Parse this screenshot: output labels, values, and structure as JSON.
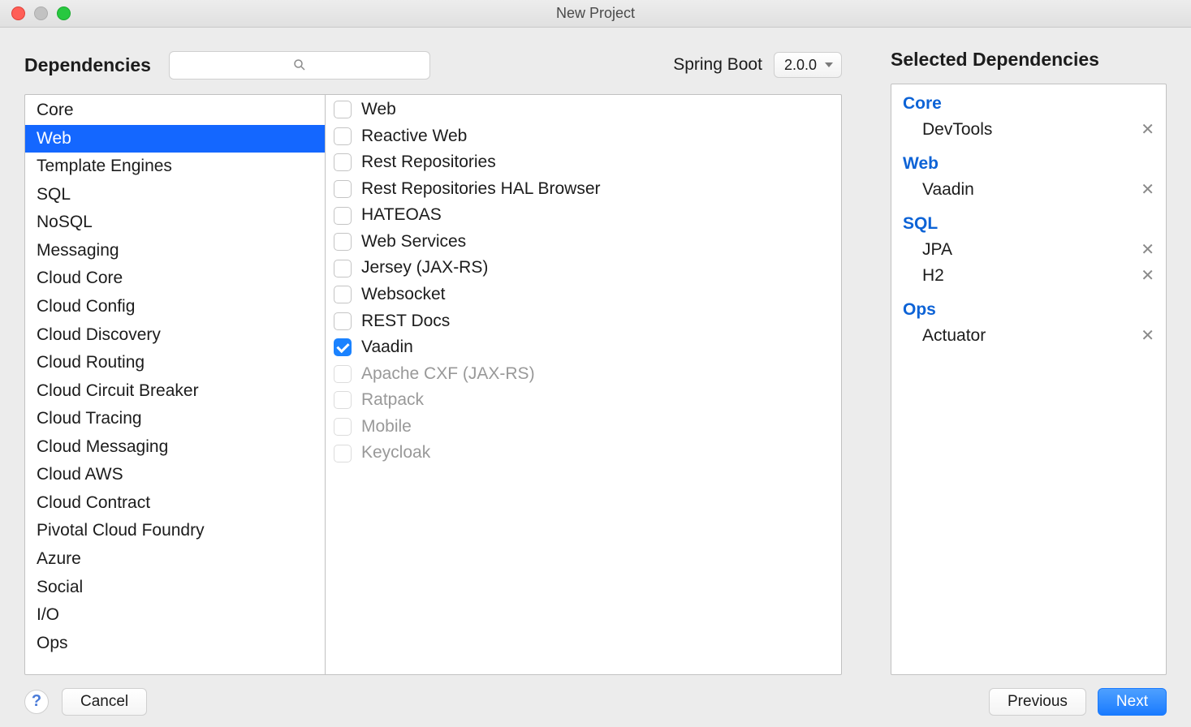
{
  "window": {
    "title": "New Project"
  },
  "header": {
    "dependencies_label": "Dependencies",
    "search_placeholder": "",
    "spring_boot_label": "Spring Boot",
    "spring_boot_version": "2.0.0"
  },
  "categories": [
    {
      "label": "Core",
      "selected": false
    },
    {
      "label": "Web",
      "selected": true
    },
    {
      "label": "Template Engines",
      "selected": false
    },
    {
      "label": "SQL",
      "selected": false
    },
    {
      "label": "NoSQL",
      "selected": false
    },
    {
      "label": "Messaging",
      "selected": false
    },
    {
      "label": "Cloud Core",
      "selected": false
    },
    {
      "label": "Cloud Config",
      "selected": false
    },
    {
      "label": "Cloud Discovery",
      "selected": false
    },
    {
      "label": "Cloud Routing",
      "selected": false
    },
    {
      "label": "Cloud Circuit Breaker",
      "selected": false
    },
    {
      "label": "Cloud Tracing",
      "selected": false
    },
    {
      "label": "Cloud Messaging",
      "selected": false
    },
    {
      "label": "Cloud AWS",
      "selected": false
    },
    {
      "label": "Cloud Contract",
      "selected": false
    },
    {
      "label": "Pivotal Cloud Foundry",
      "selected": false
    },
    {
      "label": "Azure",
      "selected": false
    },
    {
      "label": "Social",
      "selected": false
    },
    {
      "label": "I/O",
      "selected": false
    },
    {
      "label": "Ops",
      "selected": false
    }
  ],
  "options": [
    {
      "label": "Web",
      "checked": false,
      "disabled": false
    },
    {
      "label": "Reactive Web",
      "checked": false,
      "disabled": false
    },
    {
      "label": "Rest Repositories",
      "checked": false,
      "disabled": false
    },
    {
      "label": "Rest Repositories HAL Browser",
      "checked": false,
      "disabled": false
    },
    {
      "label": "HATEOAS",
      "checked": false,
      "disabled": false
    },
    {
      "label": "Web Services",
      "checked": false,
      "disabled": false
    },
    {
      "label": "Jersey (JAX-RS)",
      "checked": false,
      "disabled": false
    },
    {
      "label": "Websocket",
      "checked": false,
      "disabled": false
    },
    {
      "label": "REST Docs",
      "checked": false,
      "disabled": false
    },
    {
      "label": "Vaadin",
      "checked": true,
      "disabled": false
    },
    {
      "label": "Apache CXF (JAX-RS)",
      "checked": false,
      "disabled": true
    },
    {
      "label": "Ratpack",
      "checked": false,
      "disabled": true
    },
    {
      "label": "Mobile",
      "checked": false,
      "disabled": true
    },
    {
      "label": "Keycloak",
      "checked": false,
      "disabled": true
    }
  ],
  "selected": {
    "title": "Selected Dependencies",
    "groups": [
      {
        "name": "Core",
        "items": [
          "DevTools"
        ]
      },
      {
        "name": "Web",
        "items": [
          "Vaadin"
        ]
      },
      {
        "name": "SQL",
        "items": [
          "JPA",
          "H2"
        ]
      },
      {
        "name": "Ops",
        "items": [
          "Actuator"
        ]
      }
    ]
  },
  "footer": {
    "help": "?",
    "cancel": "Cancel",
    "previous": "Previous",
    "next": "Next"
  }
}
